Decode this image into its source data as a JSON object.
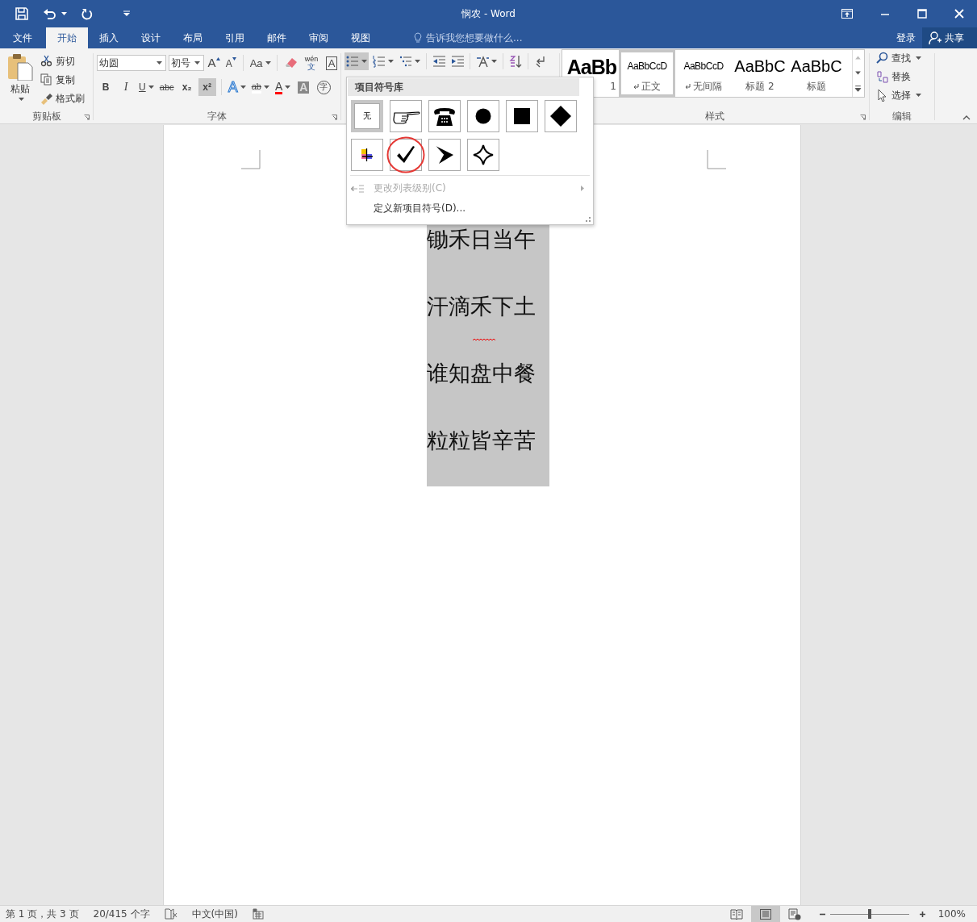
{
  "title_bar": {
    "title": "悯农 - Word"
  },
  "ribbon_tabs": [
    {
      "label": "文件",
      "selected": false
    },
    {
      "label": "开始",
      "selected": true
    },
    {
      "label": "插入",
      "selected": false
    },
    {
      "label": "设计",
      "selected": false
    },
    {
      "label": "布局",
      "selected": false
    },
    {
      "label": "引用",
      "selected": false
    },
    {
      "label": "邮件",
      "selected": false
    },
    {
      "label": "审阅",
      "selected": false
    },
    {
      "label": "视图",
      "selected": false
    }
  ],
  "tell_me": {
    "placeholder": "告诉我您想要做什么..."
  },
  "account": {
    "sign_in": "登录",
    "share": "共享"
  },
  "clipboard": {
    "label": "剪贴板",
    "paste": "粘贴",
    "actions": [
      {
        "kind": "cut",
        "label": "剪切"
      },
      {
        "kind": "copy",
        "label": "复制"
      },
      {
        "kind": "painter",
        "label": "格式刷"
      }
    ]
  },
  "font": {
    "label": "字体",
    "font_name": "幼圆",
    "font_size": "初号",
    "tools_top": [
      {
        "kind": "grow",
        "text": "A"
      },
      {
        "kind": "shrink",
        "text": "A"
      },
      {
        "kind": "case",
        "text": "Aa"
      },
      {
        "kind": "clear"
      },
      {
        "kind": "phonetic",
        "text": "wén",
        "sub": "文"
      },
      {
        "kind": "border",
        "text": "A"
      }
    ],
    "tools_bottom": [
      {
        "kind": "bold",
        "text": "B",
        "on": false
      },
      {
        "kind": "italic",
        "text": "I",
        "on": false
      },
      {
        "kind": "underline",
        "text": "U",
        "on": false
      },
      {
        "kind": "strike",
        "text": "abc",
        "on": false
      },
      {
        "kind": "subscript",
        "text": "x₂",
        "on": false
      },
      {
        "kind": "superscript",
        "text": "x²",
        "on": true
      },
      {
        "kind": "effects",
        "text": "A"
      },
      {
        "kind": "highlight",
        "text": "ab"
      },
      {
        "kind": "color",
        "text": "A"
      },
      {
        "kind": "shading",
        "text": "A"
      },
      {
        "kind": "enclose",
        "text": "字"
      }
    ]
  },
  "paragraph": {
    "tools": [
      {
        "kind": "bullets",
        "pressed": true
      },
      {
        "kind": "numbering",
        "pressed": false
      },
      {
        "kind": "multilevel",
        "pressed": false
      },
      {
        "kind": "outdent",
        "pressed": false
      },
      {
        "kind": "indent",
        "pressed": false
      },
      {
        "kind": "asian_layout",
        "pressed": false
      },
      {
        "kind": "sort",
        "pressed": false
      },
      {
        "kind": "marks",
        "pressed": false
      }
    ]
  },
  "styles": {
    "label": "样式",
    "items": [
      {
        "kind": "heading1",
        "preview": "AaBb",
        "name": "1",
        "selected": false,
        "linked": false
      },
      {
        "kind": "normal",
        "preview": "AaBbCcD",
        "name": "正文",
        "selected": true,
        "linked": true
      },
      {
        "kind": "normal",
        "preview": "AaBbCcD",
        "name": "无间隔",
        "selected": false,
        "linked": true
      },
      {
        "kind": "heading2",
        "preview": "AaBbC",
        "name": "标题 2",
        "selected": false,
        "linked": false
      },
      {
        "kind": "heading2",
        "preview": "AaBbC",
        "name": "标题",
        "selected": false,
        "linked": false
      }
    ]
  },
  "editing": {
    "label": "编辑",
    "actions": [
      {
        "kind": "find",
        "label": "查找",
        "dropdown": true
      },
      {
        "kind": "replace",
        "label": "替换",
        "dropdown": false
      },
      {
        "kind": "select",
        "label": "选择",
        "dropdown": true
      }
    ]
  },
  "bullet_menu": {
    "header": "项目符号库",
    "bullets": [
      {
        "kind": "none",
        "label": "无",
        "selected": true,
        "circled": false
      },
      {
        "kind": "hand",
        "selected": false,
        "circled": false
      },
      {
        "kind": "phone",
        "selected": false,
        "circled": false
      },
      {
        "kind": "circle",
        "selected": false,
        "circled": false
      },
      {
        "kind": "square",
        "selected": false,
        "circled": false
      },
      {
        "kind": "diamond",
        "selected": false,
        "circled": false
      },
      {
        "kind": "picture",
        "selected": false,
        "circled": false
      },
      {
        "kind": "check",
        "selected": false,
        "circled": true
      },
      {
        "kind": "arrowhead",
        "selected": false,
        "circled": false
      },
      {
        "kind": "star",
        "selected": false,
        "circled": false
      }
    ],
    "items": [
      {
        "label": "更改列表级别(C)",
        "disabled": true,
        "submenu": true
      },
      {
        "label": "定义新项目符号(D)...",
        "disabled": false,
        "submenu": false
      }
    ]
  },
  "document": {
    "selected": true,
    "lines": [
      {
        "text": "锄禾日当午",
        "spelling_error": false
      },
      {
        "text": "汗滴禾下土",
        "spelling_error": true
      },
      {
        "text": "谁知盘中餐",
        "spelling_error": false
      },
      {
        "text": "粒粒皆辛苦",
        "spelling_error": false
      }
    ]
  },
  "status_bar": {
    "page": "第 1 页，共 3 页",
    "words": "20/415 个字",
    "language": "中文(中国)",
    "views": [
      {
        "kind": "read",
        "selected": false
      },
      {
        "kind": "print",
        "selected": true
      },
      {
        "kind": "web",
        "selected": false
      }
    ],
    "zoom": {
      "level": 0.5,
      "text": "100%"
    }
  }
}
